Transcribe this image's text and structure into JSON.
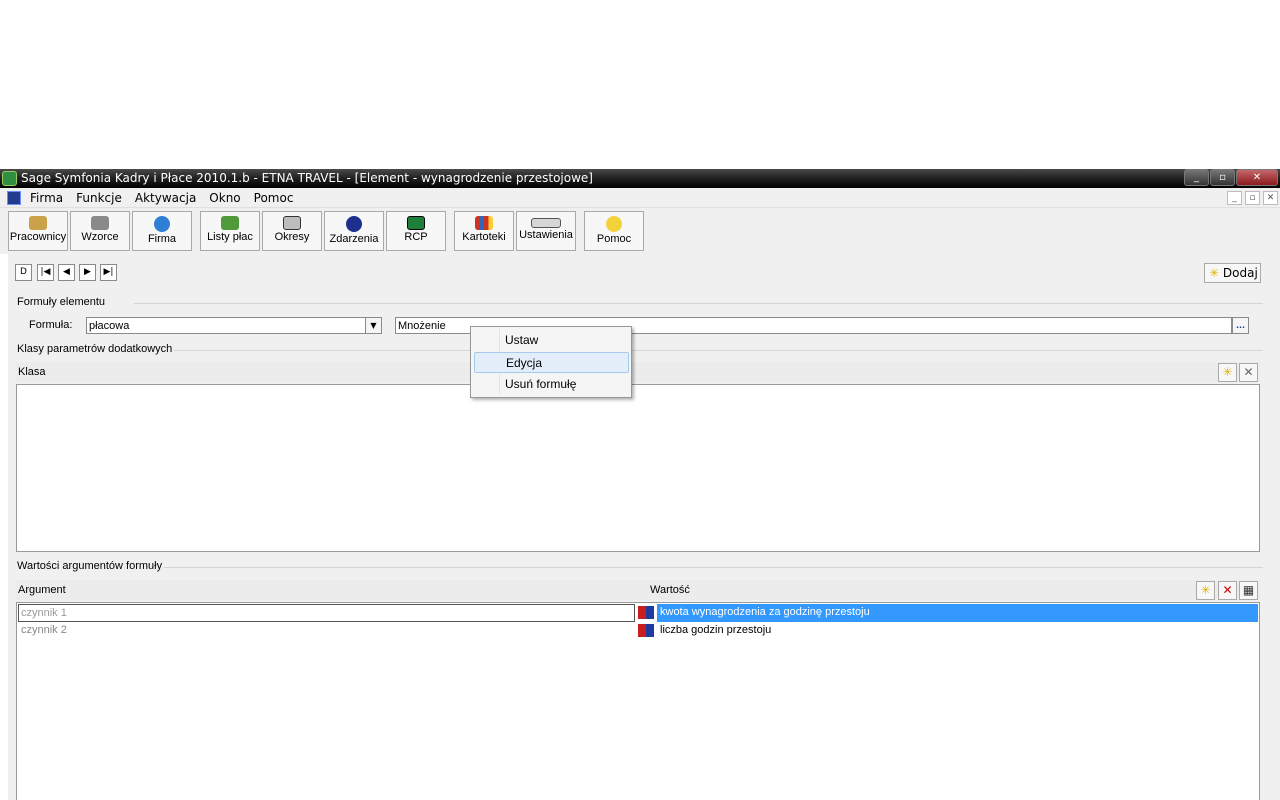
{
  "window": {
    "title": "Sage Symfonia Kadry i Płace 2010.1.b - ETNA TRAVEL - [Element - wynagrodzenie przestojowe]",
    "buttons": [
      "minimize",
      "restore",
      "close"
    ]
  },
  "menu": {
    "items": [
      "Firma",
      "Funkcje",
      "Aktywacja",
      "Okno",
      "Pomoc"
    ]
  },
  "toolbar": {
    "buttons": [
      {
        "label": "Pracownicy",
        "icon": "people-icon"
      },
      {
        "label": "Wzorce",
        "icon": "templates-icon"
      },
      {
        "label": "Firma",
        "icon": "globe-icon"
      },
      {
        "label": "Listy płac",
        "icon": "money-icon"
      },
      {
        "label": "Okresy",
        "icon": "calendar-icon"
      },
      {
        "label": "Zdarzenia",
        "icon": "exclamation-icon"
      },
      {
        "label": "RCP",
        "icon": "rcp-icon"
      },
      {
        "label": "Kartoteki",
        "icon": "binders-icon"
      },
      {
        "label": "Ustawienia",
        "icon": "sliders-icon"
      },
      {
        "label": "Pomoc",
        "icon": "help-icon"
      }
    ]
  },
  "nav": {
    "buttons": [
      "D",
      "|◀",
      "◀",
      "▶",
      "▶|"
    ]
  },
  "add_button": {
    "label": "Dodaj"
  },
  "formulas": {
    "group_title": "Formuły elementu",
    "formula_label": "Formuła:",
    "formula_value": "płacowa",
    "operation_value": "Mnożenie",
    "more_button": "..."
  },
  "classes": {
    "group_title": "Klasy parametrów dodatkowych",
    "column_header": "Klasa"
  },
  "arguments": {
    "group_title": "Wartości argumentów formuły",
    "col_argument": "Argument",
    "col_value": "Wartość",
    "rows": [
      {
        "argument": "czynnik 1",
        "value": "kwota wynagrodzenia za godzinę przestoju"
      },
      {
        "argument": "czynnik 2",
        "value": "liczba godzin przestoju"
      }
    ]
  },
  "context_menu": {
    "items": [
      "Ustaw",
      "Edycja",
      "Usuń formułę"
    ],
    "highlighted": "Edycja"
  }
}
